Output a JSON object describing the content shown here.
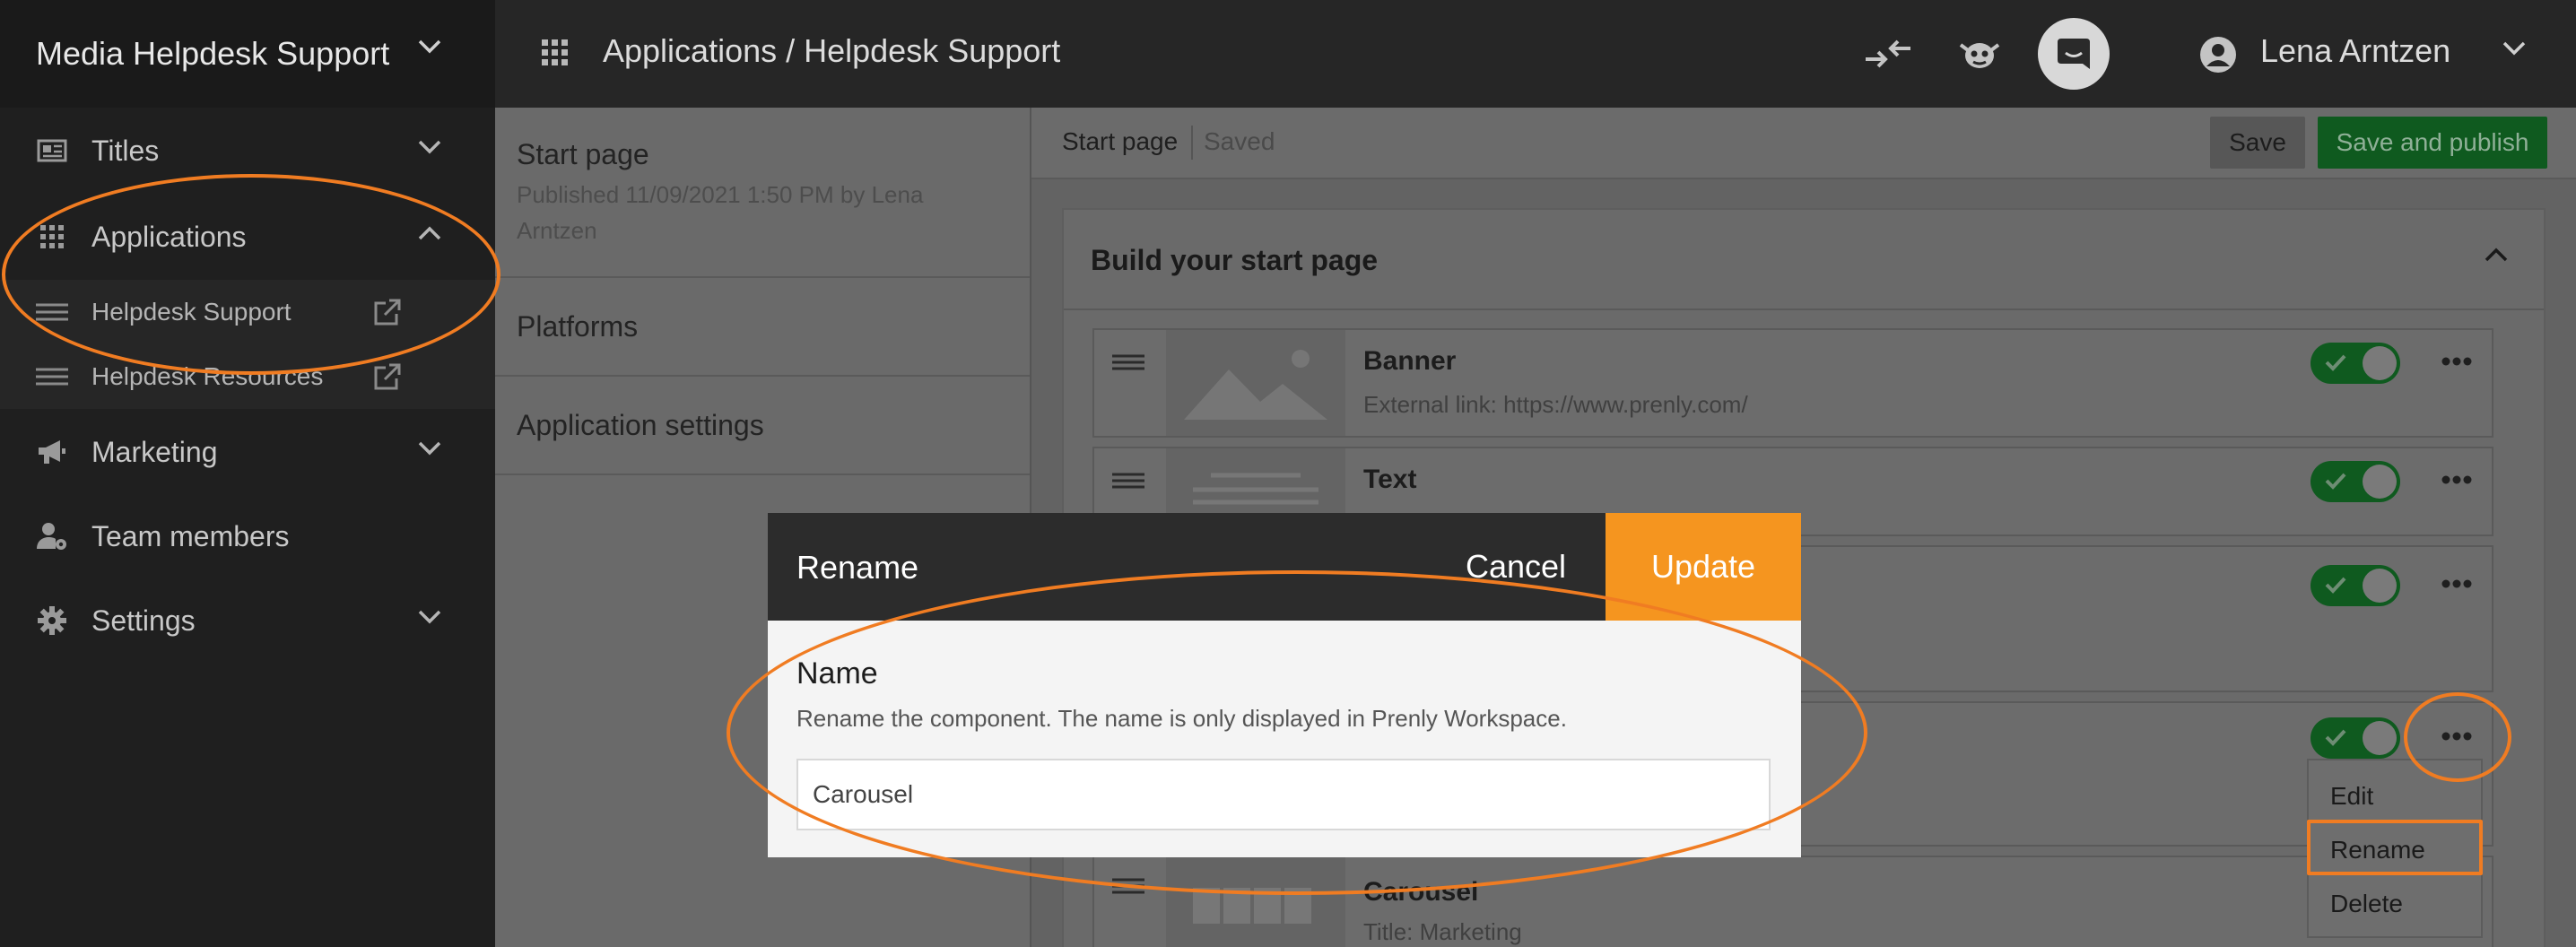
{
  "sidebar": {
    "workspace": "Media Helpdesk Support",
    "items": [
      {
        "label": "Titles",
        "icon": "newspaper-icon"
      },
      {
        "label": "Applications",
        "icon": "apps-grid-icon"
      },
      {
        "label": "Marketing",
        "icon": "megaphone-icon"
      },
      {
        "label": "Team members",
        "icon": "user-gear-icon"
      },
      {
        "label": "Settings",
        "icon": "gear-icon"
      }
    ],
    "sub_items": [
      {
        "label": "Helpdesk Support"
      },
      {
        "label": "Helpdesk Resources"
      }
    ]
  },
  "topbar": {
    "breadcrumb": "Applications / Helpdesk Support",
    "user": "Lena Arntzen"
  },
  "midpanel": {
    "start_page": {
      "title": "Start page",
      "subtitle_line1": "Published 11/09/2021 1:50 PM by Lena",
      "subtitle_line2": "Arntzen"
    },
    "platforms": "Platforms",
    "app_settings": "Application settings"
  },
  "content": {
    "page_label": "Start page",
    "status": "Saved",
    "save_label": "Save",
    "publish_label": "Save and publish",
    "builder_title": "Build your start page",
    "components": [
      {
        "title": "Banner",
        "subtitle": "External link: https://www.prenly.com/"
      },
      {
        "title": "Text",
        "subtitle": ""
      },
      {
        "title": "",
        "subtitle": ""
      },
      {
        "title": "",
        "subtitle": ""
      },
      {
        "title": "Carousel",
        "subtitle": "Title: Marketing"
      }
    ],
    "menu": [
      "Edit",
      "Rename",
      "Delete"
    ]
  },
  "modal": {
    "title": "Rename",
    "cancel": "Cancel",
    "update": "Update",
    "field_label": "Name",
    "help": "Rename the component. The name is only displayed in Prenly Workspace.",
    "value": "Carousel"
  },
  "colors": {
    "accent": "#f5951f",
    "annotation": "#f07c22",
    "toggle_on": "#0f5a1f"
  }
}
